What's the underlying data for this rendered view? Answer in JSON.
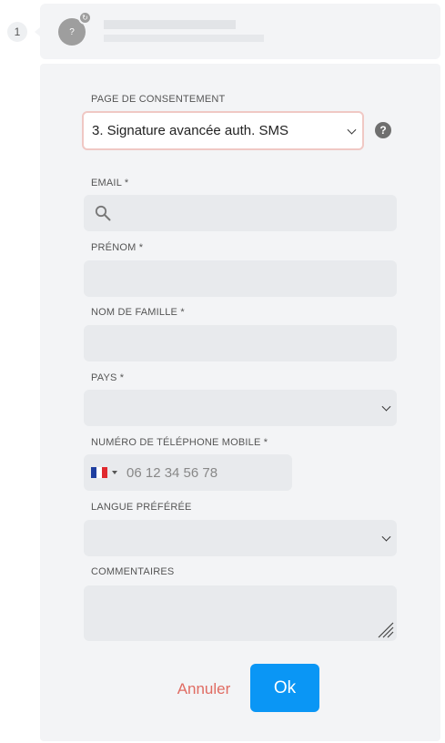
{
  "step": {
    "number": "1"
  },
  "header": {
    "avatar_glyph": "?",
    "badge_glyph": "↻"
  },
  "form": {
    "consent_page": {
      "label": "PAGE DE CONSENTEMENT",
      "selected": "3. Signature avancée auth. SMS",
      "help_glyph": "?"
    },
    "email": {
      "label": "EMAIL *",
      "value": ""
    },
    "first_name": {
      "label": "PRÉNOM *",
      "value": ""
    },
    "last_name": {
      "label": "NOM DE FAMILLE *",
      "value": ""
    },
    "country": {
      "label": "PAYS *",
      "selected": ""
    },
    "mobile": {
      "label": "NUMÉRO DE TÉLÉPHONE MOBILE *",
      "placeholder": "06 12 34 56 78",
      "country_flag": "FR"
    },
    "language": {
      "label": "LANGUE PRÉFÉRÉE",
      "selected": ""
    },
    "comments": {
      "label": "COMMENTAIRES",
      "value": ""
    }
  },
  "actions": {
    "cancel_label": "Annuler",
    "ok_label": "Ok"
  },
  "colors": {
    "card_bg": "#f3f4f6",
    "field_bg": "#e8eaed",
    "focus_border": "#f0c8c4",
    "primary": "#0a96f5",
    "cancel_text": "#e06c63"
  }
}
